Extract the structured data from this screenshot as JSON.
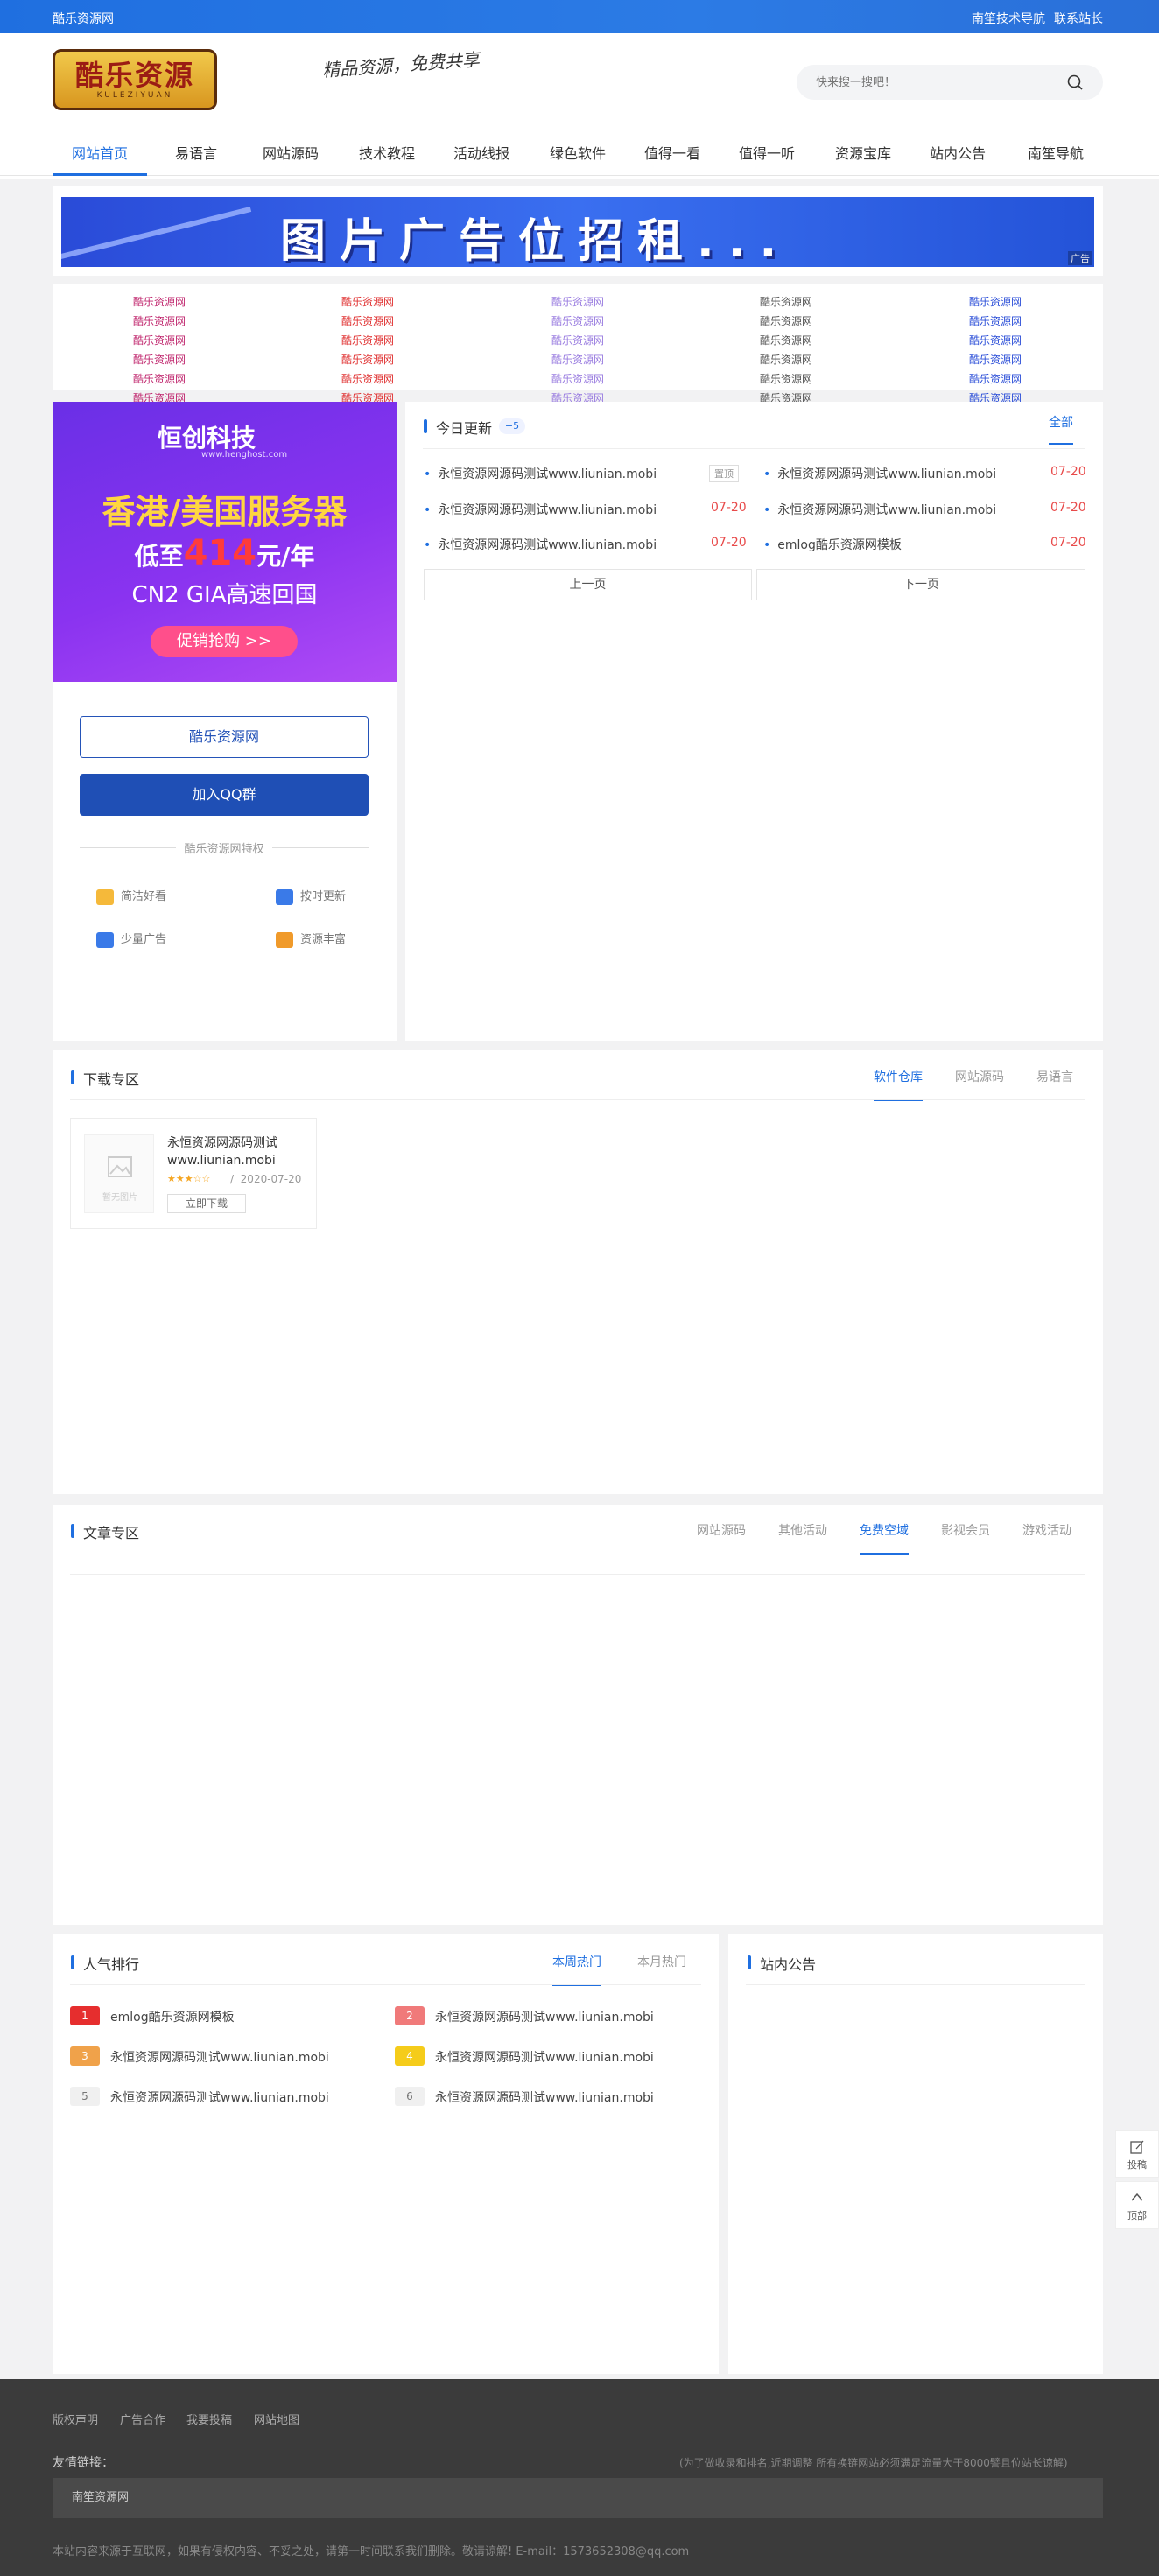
{
  "topbar": {
    "site": "酷乐资源网",
    "links": [
      "南笙技术导航",
      "联系站长"
    ]
  },
  "header": {
    "logo_text": "酷乐资源",
    "logo_sub": "KULEZIYUAN",
    "slogan": "精品资源，免费共享",
    "search_placeholder": "快来搜一搜吧！"
  },
  "nav": [
    "网站首页",
    "易语言",
    "网站源码",
    "技术教程",
    "活动线报",
    "绿色软件",
    "值得一看",
    "值得一听",
    "资源宝库",
    "站内公告",
    "南笙导航"
  ],
  "banner": {
    "text": "图片广告位招租...",
    "tag": "广告"
  },
  "links": [
    [
      "酷乐资源网",
      "酷乐资源网",
      "酷乐资源网",
      "酷乐资源网",
      "酷乐资源网"
    ],
    [
      "酷乐资源网",
      "酷乐资源网",
      "酷乐资源网",
      "酷乐资源网",
      "酷乐资源网"
    ],
    [
      "酷乐资源网",
      "酷乐资源网",
      "酷乐资源网",
      "酷乐资源网",
      "酷乐资源网"
    ],
    [
      "酷乐资源网",
      "酷乐资源网",
      "酷乐资源网",
      "酷乐资源网",
      "酷乐资源网"
    ],
    [
      "酷乐资源网",
      "酷乐资源网",
      "酷乐资源网",
      "酷乐资源网",
      "酷乐资源网"
    ],
    [
      "酷乐资源网",
      "酷乐资源网",
      "酷乐资源网",
      "酷乐资源网",
      "酷乐资源网"
    ]
  ],
  "link_colors": [
    "#c0276e",
    "#e03232",
    "#9a7de0",
    "#555555",
    "#2c4fd8"
  ],
  "ad": {
    "brand": "恒创科技",
    "url": "www.henghost.com",
    "headline": "香港/美国服务器",
    "price_pre": "低至",
    "price": "414",
    "price_post": "元/年",
    "line3": "CN2 GIA高速回国",
    "cta": "促销抢购 >>"
  },
  "sidebar": {
    "btn_site": "酷乐资源网",
    "btn_qq": "加入QQ群",
    "privilege": "酷乐资源网特权",
    "features": [
      "简洁好看",
      "按时更新",
      "少量广告",
      "资源丰富"
    ]
  },
  "today": {
    "title": "今日更新",
    "count": "+5",
    "all": "全部",
    "top_tag": "置顶",
    "items": [
      {
        "title": "永恒资源网源码测试www.liunian.mobi",
        "date": ""
      },
      {
        "title": "永恒资源网源码测试www.liunian.mobi",
        "date": "07-20"
      },
      {
        "title": "永恒资源网源码测试www.liunian.mobi",
        "date": "07-20"
      },
      {
        "title": "永恒资源网源码测试www.liunian.mobi",
        "date": "07-20"
      },
      {
        "title": "永恒资源网源码测试www.liunian.mobi",
        "date": "07-20"
      },
      {
        "title": "emlog酷乐资源网模板",
        "date": "07-20"
      }
    ],
    "prev": "上一页",
    "next": "下一页"
  },
  "download": {
    "title": "下载专区",
    "tabs": [
      "软件仓库",
      "网站源码",
      "易语言"
    ],
    "item": {
      "img_text": "暂无图片",
      "title": "永恒资源网源码测试www.liunian.mobi",
      "stars": "★★★☆☆",
      "date": "2020-07-20",
      "button": "立即下载"
    }
  },
  "articles": {
    "title": "文章专区",
    "tabs": [
      "网站源码",
      "其他活动",
      "免费空域",
      "影视会员",
      "游戏活动"
    ]
  },
  "rank": {
    "title": "人气排行",
    "tabs": [
      "本周热门",
      "本月热门"
    ],
    "items": [
      {
        "n": "1",
        "title": "emlog酷乐资源网模板",
        "color": "#e62e2e"
      },
      {
        "n": "2",
        "title": "永恒资源网源码测试www.liunian.mobi",
        "color": "#f07a7a"
      },
      {
        "n": "3",
        "title": "永恒资源网源码测试www.liunian.mobi",
        "color": "#f0a24a"
      },
      {
        "n": "4",
        "title": "永恒资源网源码测试www.liunian.mobi",
        "color": "#f5cc1a"
      },
      {
        "n": "5",
        "title": "永恒资源网源码测试www.liunian.mobi",
        "color": "#f0f0f0"
      },
      {
        "n": "6",
        "title": "永恒资源网源码测试www.liunian.mobi",
        "color": "#f0f0f0"
      }
    ]
  },
  "notice": {
    "title": "站内公告"
  },
  "side_buttons": [
    "投稿",
    "顶部"
  ],
  "footer": {
    "links": [
      "版权声明",
      "广告合作",
      "我要投稿",
      "网站地图"
    ],
    "friend_label": "友情链接：",
    "friend_note": "(为了做收录和排名,近期调整 所有换链网站必须满足流量大于8000譬且位站长谅解)",
    "friend_link": "南笙资源网",
    "copyright": "本站内容来源于互联网，如果有侵权内容、不妥之处，请第一时间联系我们删除。敬请谅解! E-mail：1573652308@qq.com"
  }
}
